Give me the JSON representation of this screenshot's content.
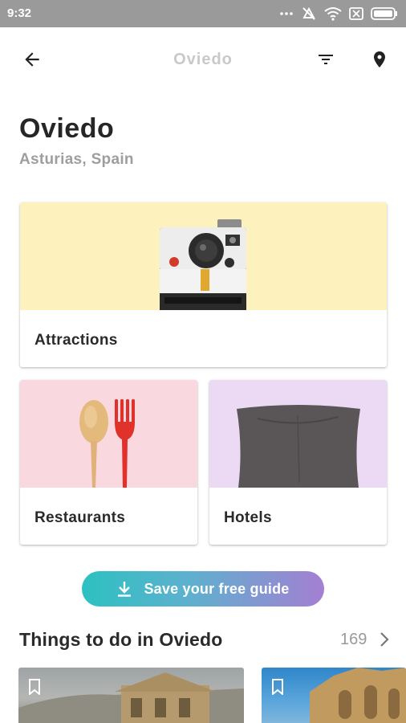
{
  "status_bar": {
    "time": "9:32",
    "icons": [
      "more-dots-icon",
      "alarm-off-icon",
      "wifi-icon",
      "sim-off-icon",
      "battery-icon"
    ]
  },
  "app_bar": {
    "title": "Oviedo",
    "back_icon": "arrow-left-icon",
    "filter_icon": "filter-icon",
    "map_icon": "map-pin-icon"
  },
  "header": {
    "city": "Oviedo",
    "region": "Asturias, Spain"
  },
  "categories": [
    {
      "label": "Attractions",
      "image": "polaroid-camera",
      "color": "#fdf2bd"
    },
    {
      "label": "Restaurants",
      "image": "spoon-and-fork",
      "color": "#fad8e0"
    },
    {
      "label": "Hotels",
      "image": "pillow",
      "color": "#ecdaf4"
    }
  ],
  "save_guide": {
    "label": "Save your free guide",
    "icon": "download-icon",
    "gradient": [
      "#2cc1c1",
      "#a47fd2"
    ]
  },
  "things_to_do": {
    "title": "Things to do in Oviedo",
    "count": "169",
    "items": [
      {
        "image": "stone-church-photo",
        "bookmark_icon": "bookmark-icon"
      },
      {
        "image": "cathedral-photo",
        "bookmark_icon": "bookmark-icon"
      }
    ]
  }
}
